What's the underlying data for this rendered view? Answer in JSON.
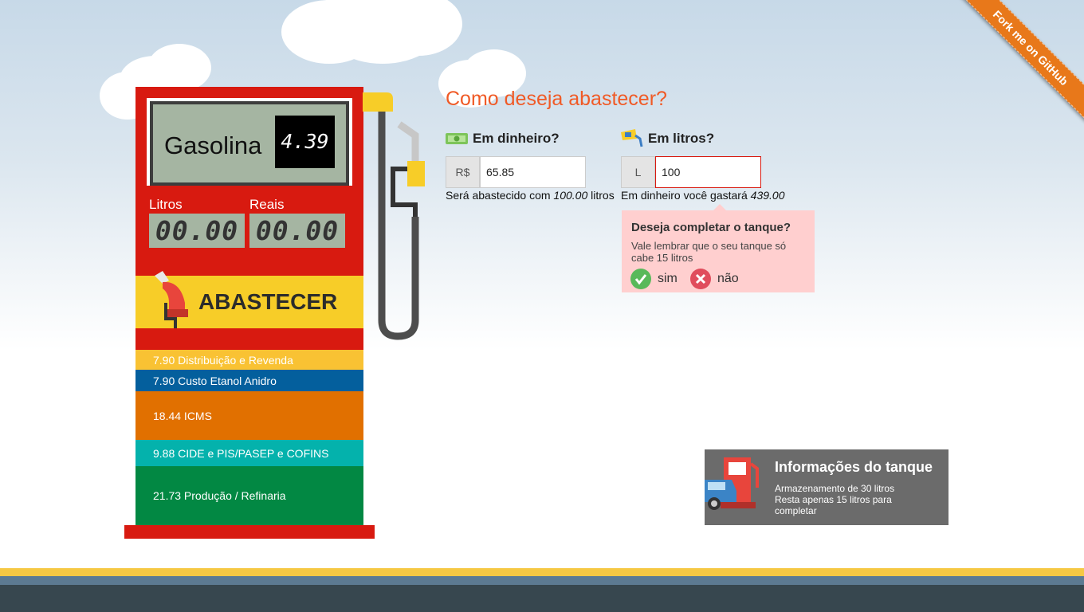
{
  "ribbon": {
    "label": "Fork me on GitHub"
  },
  "pump": {
    "fuel_name": "Gasolina",
    "price": "4.39",
    "liters_label": "Litros",
    "reais_label": "Reais",
    "liters_display": "00.00",
    "reais_display": "00.00",
    "fill_button_label": "ABASTECER",
    "colors": {
      "body": "#d81a10",
      "display": "#a5b5a2",
      "button": "#f7cd28"
    }
  },
  "cost_breakdown": [
    {
      "label": "7.90 Distribuição e Revenda",
      "color": "#f9c233"
    },
    {
      "label": "7.90 Custo Etanol Anidro",
      "color": "#045f9d"
    },
    {
      "label": "18.44 ICMS",
      "color": "#e17000"
    },
    {
      "label": "9.88 CIDE e PIS/PASEP e COFINS",
      "color": "#04b2ac"
    },
    {
      "label": "21.73 Produção / Refinaria",
      "color": "#028843"
    }
  ],
  "form": {
    "question": "Como deseja abastecer?",
    "money": {
      "label": "Em dinheiro?",
      "prefix": "R$",
      "value": "65.85",
      "hint_prefix": "Será abastecido com",
      "hint_value": "100.00",
      "hint_suffix": "litros"
    },
    "liters": {
      "label": "Em litros?",
      "prefix": "L",
      "value": "100",
      "hint_prefix": "Em dinheiro você gastará",
      "hint_value": "439.00"
    }
  },
  "popup": {
    "title": "Deseja completar o tanque?",
    "text": "Vale lembrar que o seu tanque só cabe 15 litros",
    "yes_label": "sim",
    "no_label": "não"
  },
  "tank_info": {
    "title": "Informações do tanque",
    "line1": "Armazenamento de 30 litros",
    "line2": "Resta apenas 15 litros para completar"
  }
}
